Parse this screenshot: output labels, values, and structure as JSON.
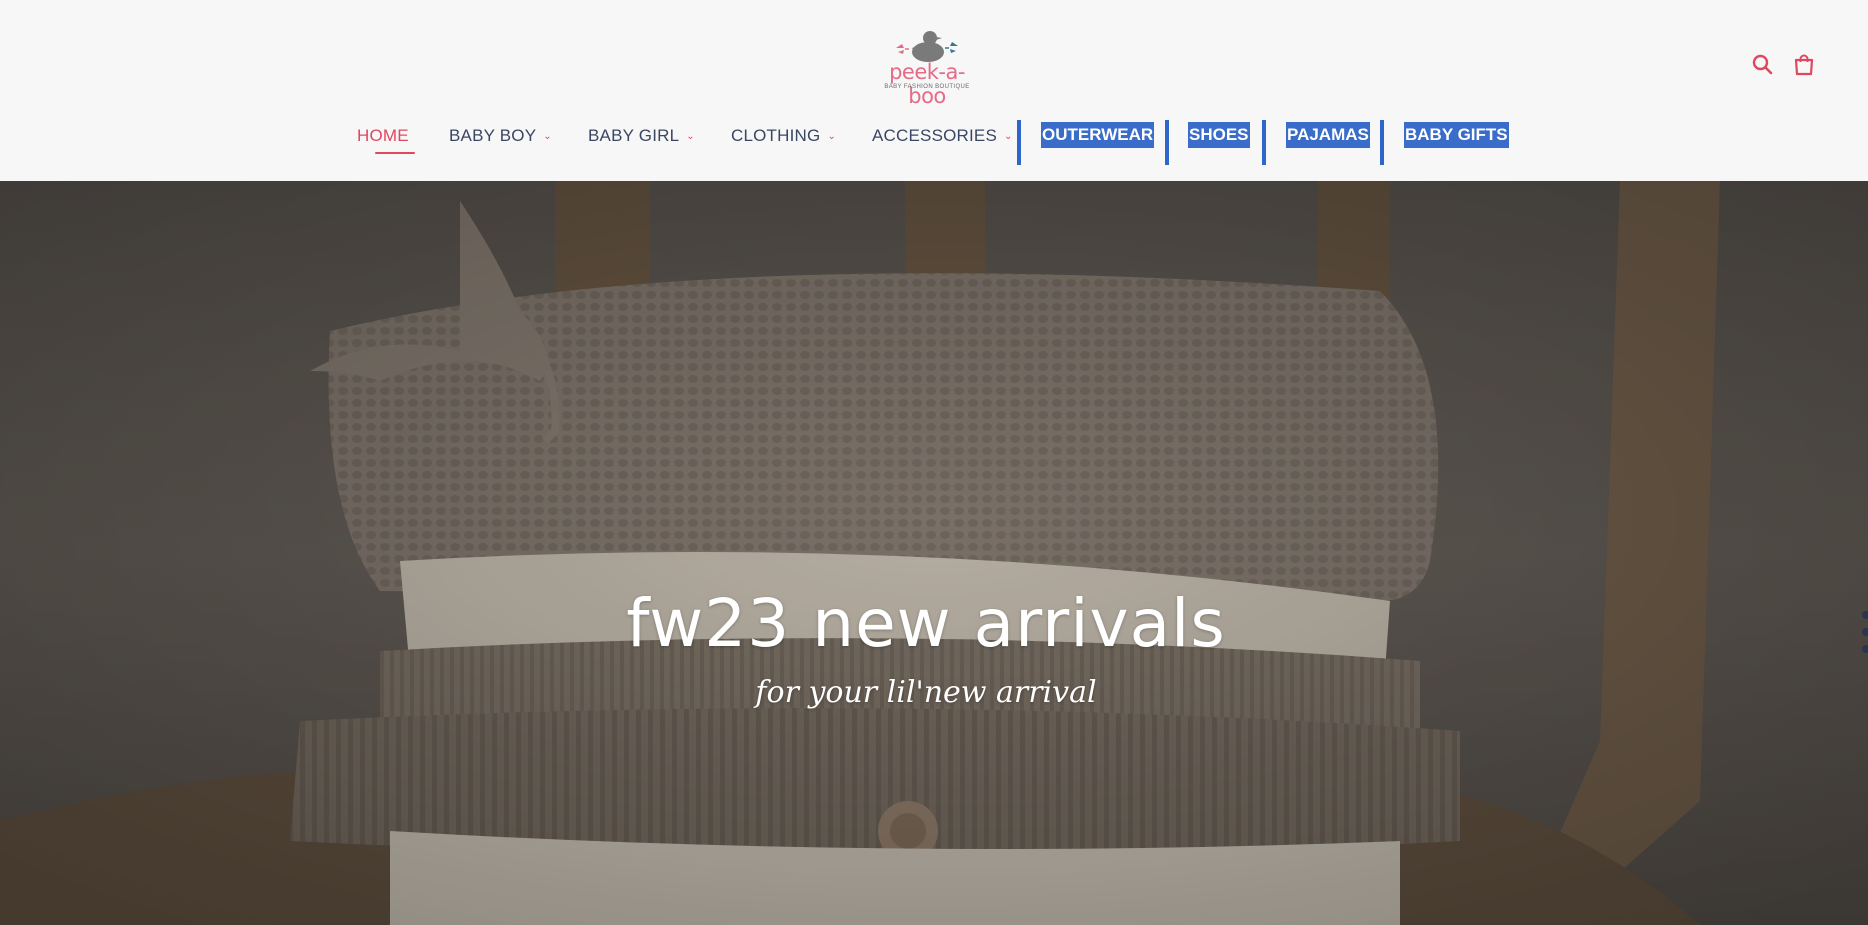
{
  "brand": {
    "name": "peek-a-boo",
    "tagline": "BABY FASHION BOUTIQUE"
  },
  "header_icons": {
    "search": "search-icon",
    "cart": "shopping-bag-icon"
  },
  "nav": {
    "home": "HOME",
    "baby_boy": "BABY BOY",
    "baby_girl": "BABY GIRL",
    "clothing": "CLOTHING",
    "accessories": "ACCESSORIES",
    "outerwear": "OUTERWEAR",
    "shoes": "SHOES",
    "pajamas": "PAJAMAS",
    "baby_gifts": "BABY GIFTS"
  },
  "hero": {
    "title": "fw23 new arrivals",
    "subtitle": "for your lil'new arrival"
  },
  "colors": {
    "accent": "#e0485f",
    "nav_text": "#3a4763",
    "highlight": "#3a6cc9",
    "background": "#f7f7f7"
  }
}
